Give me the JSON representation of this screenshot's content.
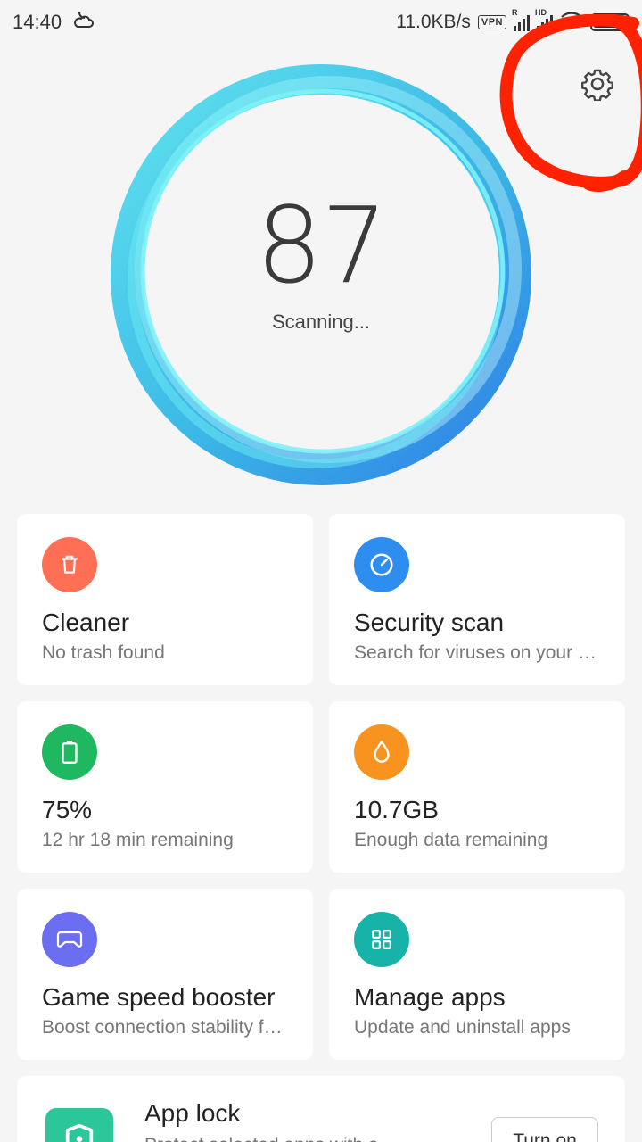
{
  "status_bar": {
    "time": "14:40",
    "weather_icon": "partly-cloudy-night-icon",
    "net_speed": "11.0KB/s",
    "vpn": "VPN",
    "sim1_tag": "R",
    "sim2_tag": "HD",
    "battery_level": 0.75
  },
  "score": {
    "value": "87",
    "status": "Scanning..."
  },
  "colors": {
    "cleaner": "#ff6f55",
    "security": "#2e8ef0",
    "battery": "#1fb760",
    "data": "#f7931e",
    "game": "#6b6ef0",
    "apps": "#17b3a8",
    "applock": "#2bc79a",
    "annotation": "#ff2200"
  },
  "cards": [
    {
      "icon": "trash-icon",
      "title": "Cleaner",
      "subtitle": "No trash found"
    },
    {
      "icon": "speedometer-icon",
      "title": "Security scan",
      "subtitle": "Search for viruses on your d..."
    },
    {
      "icon": "battery-icon",
      "title": "75%",
      "subtitle": "12 hr 18 min  remaining"
    },
    {
      "icon": "water-drop-icon",
      "title": "10.7GB",
      "subtitle": "Enough data remaining"
    },
    {
      "icon": "gamepad-icon",
      "title": "Game speed booster",
      "subtitle": "Boost connection stability fo..."
    },
    {
      "icon": "grid-icon",
      "title": "Manage apps",
      "subtitle": "Update and uninstall apps"
    }
  ],
  "app_lock": {
    "icon": "shield-lock-icon",
    "title": "App lock",
    "subtitle": "Protect selected apps with a",
    "button": "Turn on"
  }
}
